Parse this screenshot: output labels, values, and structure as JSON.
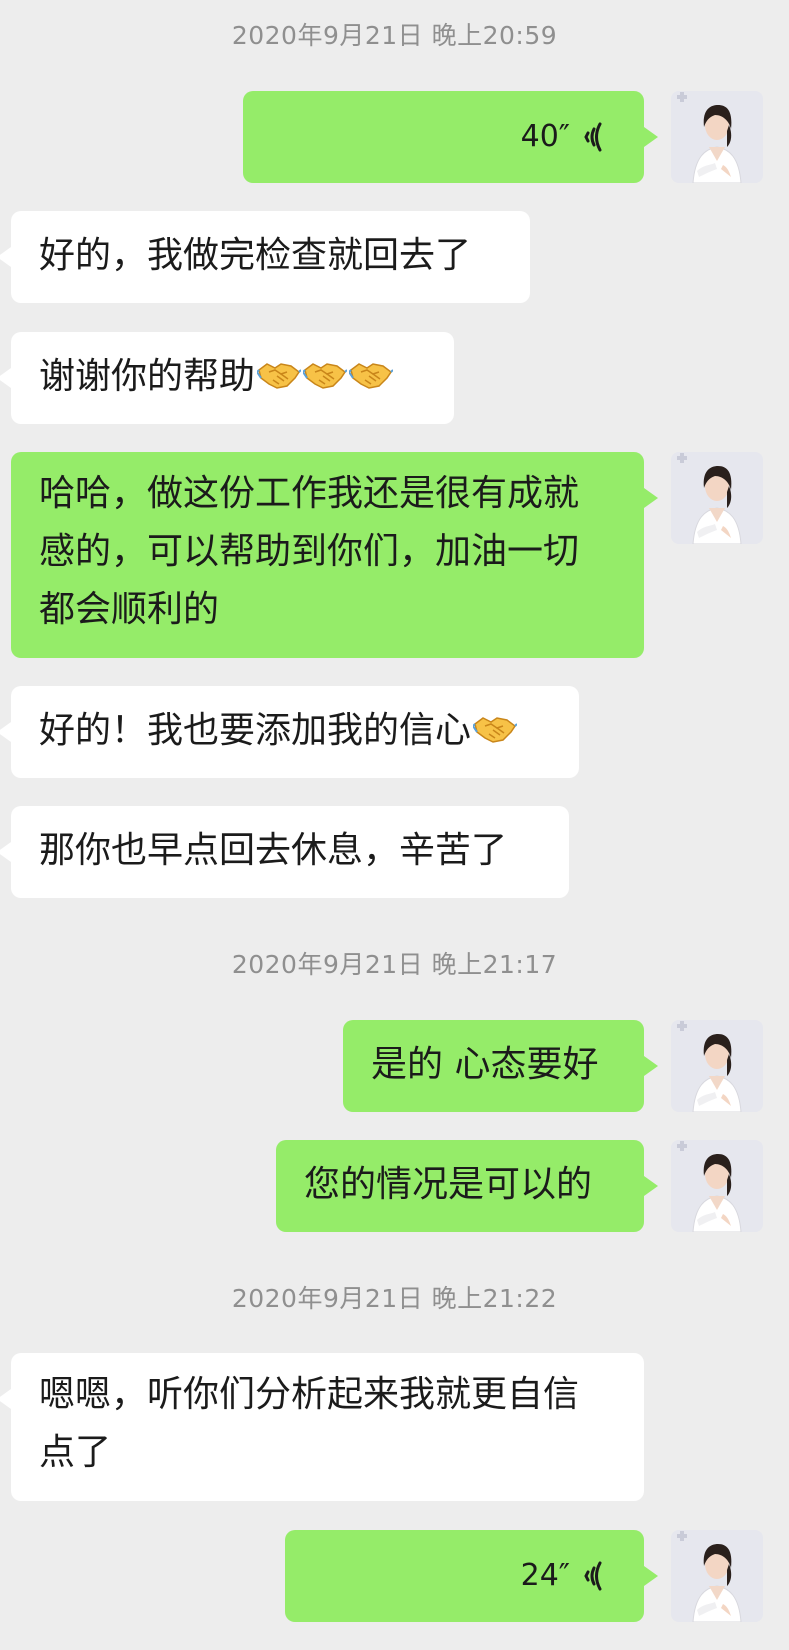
{
  "chat": {
    "timestamps": [
      "2020年9月21日 晚上20:59",
      "2020年9月21日 晚上21:17",
      "2020年9月21日 晚上21:22"
    ],
    "messages": [
      {
        "side": "out",
        "type": "voice",
        "duration": "40″"
      },
      {
        "side": "in",
        "type": "text",
        "text": "好的，我做完检查就回去了"
      },
      {
        "side": "in",
        "type": "text",
        "text": "谢谢你的帮助",
        "emoji": [
          "handshake-emoji",
          "handshake-emoji",
          "handshake-emoji"
        ]
      },
      {
        "side": "out",
        "type": "text",
        "lines": [
          "哈哈，做这份工作我还是很有成就",
          "感的，可以帮助到你们，加油一切",
          "都会顺利的"
        ]
      },
      {
        "side": "in",
        "type": "text",
        "text": "好的！我也要添加我的信心",
        "emoji": [
          "handshake-emoji"
        ]
      },
      {
        "side": "in",
        "type": "text",
        "text": "那你也早点回去休息，辛苦了"
      },
      {
        "side": "out",
        "type": "text",
        "text": "是的 心态要好"
      },
      {
        "side": "out",
        "type": "text",
        "text": "您的情况是可以的"
      },
      {
        "side": "in",
        "type": "text",
        "lines": [
          "嗯嗯，听你们分析起来我就更自信",
          "点了"
        ]
      },
      {
        "side": "out",
        "type": "voice",
        "duration": "24″"
      }
    ]
  },
  "colors": {
    "background": "#ededed",
    "outgoing_bubble": "#95ec69",
    "incoming_bubble": "#ffffff",
    "timestamp_text": "#8f8f8f"
  }
}
